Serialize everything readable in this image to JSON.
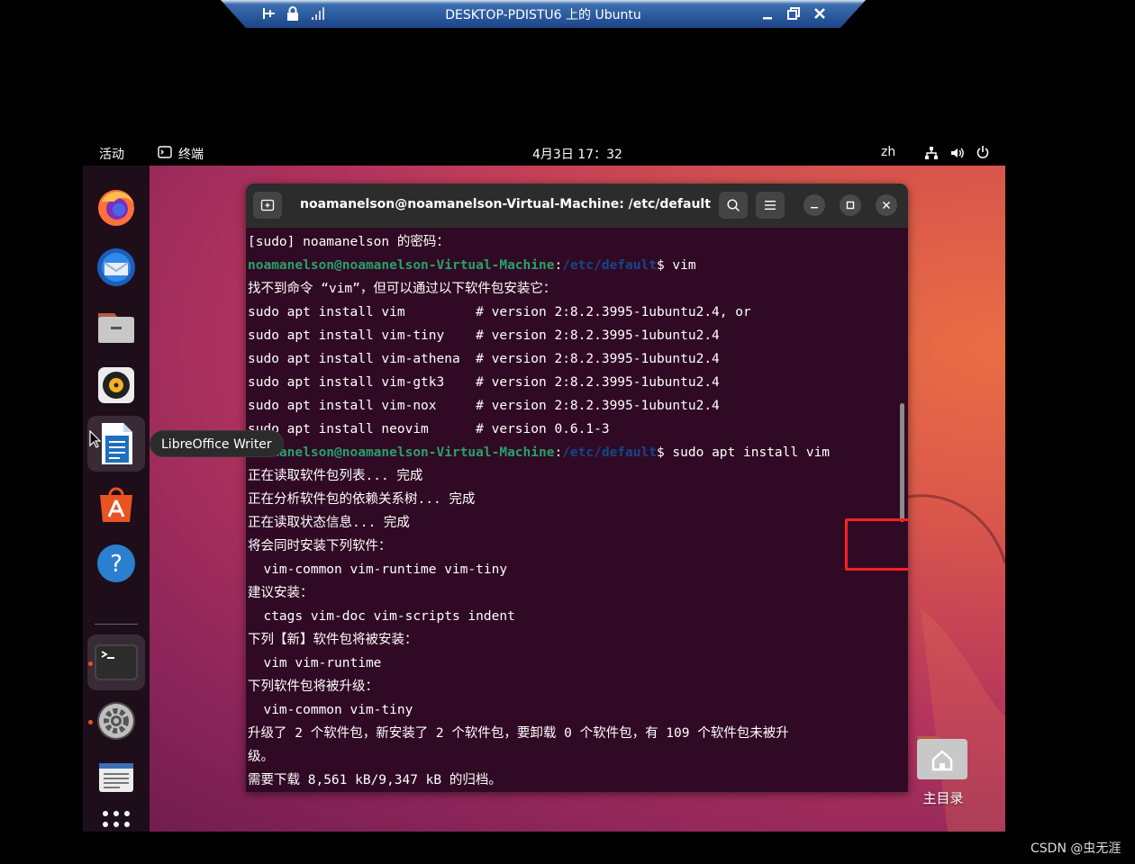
{
  "rdp": {
    "title": "DESKTOP-PDISTU6 上的 Ubuntu"
  },
  "topbar": {
    "activities": "活动",
    "app_name": "终端",
    "clock": "4月3日 17：32",
    "input_method": "zh"
  },
  "tooltip": "LibreOffice Writer",
  "terminal": {
    "title": "noamanelson@noamanelson-Virtual-Machine: /etc/default",
    "prompt": {
      "user_host": "noamanelson@noamanelson-Virtual-Machine",
      "separator": ":",
      "path": "/etc/default",
      "symbol": "$"
    },
    "lines": {
      "l1": "[sudo] noamanelson 的密码：",
      "l2_cmd": " vim",
      "l3": "找不到命令 “vim”，但可以通过以下软件包安装它：",
      "l4": "sudo apt install vim         # version 2:8.2.3995-1ubuntu2.4, or",
      "l5": "sudo apt install vim-tiny    # version 2:8.2.3995-1ubuntu2.4",
      "l6": "sudo apt install vim-athena  # version 2:8.2.3995-1ubuntu2.4",
      "l7": "sudo apt install vim-gtk3    # version 2:8.2.3995-1ubuntu2.4",
      "l8": "sudo apt install vim-nox     # version 2:8.2.3995-1ubuntu2.4",
      "l9": "sudo apt install neovim      # version 0.6.1-3",
      "l10_cmd": " sudo apt install vim",
      "l11": "正在读取软件包列表... 完成",
      "l12": "正在分析软件包的依赖关系树... 完成",
      "l13": "正在读取状态信息... 完成",
      "l14": "将会同时安装下列软件：",
      "l15": "  vim-common vim-runtime vim-tiny",
      "l16": "建议安装：",
      "l17": "  ctags vim-doc vim-scripts indent",
      "l18": "下列【新】软件包将被安装：",
      "l19": "  vim vim-runtime",
      "l20": "下列软件包将被升级：",
      "l21": "  vim-common vim-tiny",
      "l22": "升级了 2 个软件包，新安装了 2 个软件包，要卸载 0 个软件包，有 109 个软件包未被升",
      "l23": "级。",
      "l24": "需要下载 8,561 kB/9,347 kB 的归档。"
    }
  },
  "desktop": {
    "home_label": "主目录"
  },
  "watermark": "CSDN @虫无涯",
  "colors": {
    "terminal_bg": "#300a24",
    "prompt_green": "#26a269",
    "prompt_blue": "#12488b",
    "highlight_red": "#ff2020",
    "ubuntu_orange": "#e95420"
  },
  "dock_icons": [
    "firefox-icon",
    "thunderbird-icon",
    "files-icon",
    "rhythmbox-icon",
    "libreoffice-writer-icon",
    "app-center-icon",
    "help-icon",
    "terminal-icon",
    "settings-icon",
    "text-editor-icon",
    "show-apps-icon"
  ]
}
